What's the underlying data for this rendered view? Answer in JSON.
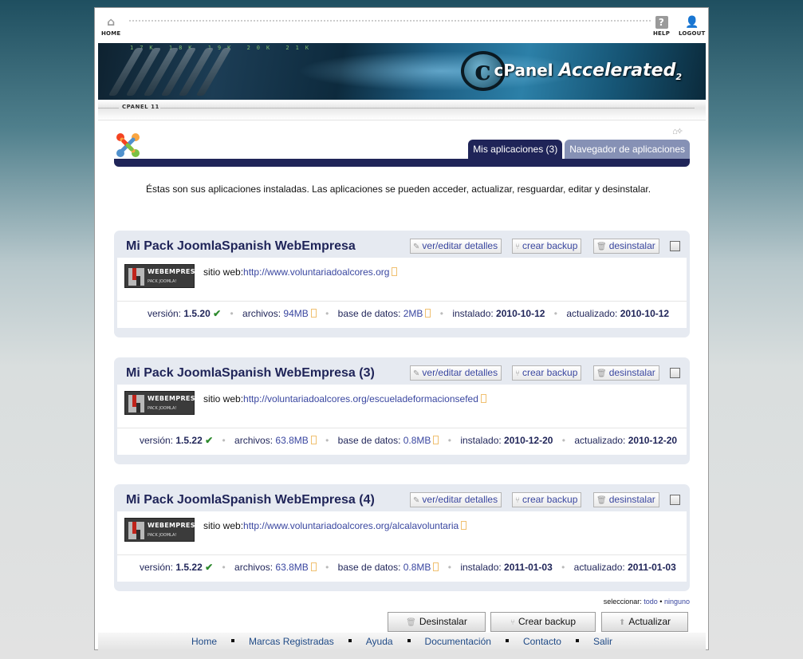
{
  "topnav": {
    "home": "HOME",
    "help": "HELP",
    "logout": "LOGOUT"
  },
  "banner": {
    "logo_c": "c",
    "brand": "cPanel",
    "accelerated": "Accelerated",
    "version": "2",
    "numbers": "17K 18K 19K 20K 21K"
  },
  "strip": {
    "label": "CPANEL 11"
  },
  "tabs": [
    {
      "label": "Mis aplicaciones (3)",
      "active": true
    },
    {
      "label": "Navegador de aplicaciones",
      "active": false
    }
  ],
  "intro": "Éstas son sus aplicaciones instaladas. Las aplicaciones se pueden acceder, actualizar, resguardar, editar y desinstalar.",
  "card_actions": {
    "edit": "ver/editar detalles",
    "backup": "crear backup",
    "uninstall": "desinstalar"
  },
  "labels": {
    "site": "sitio web:",
    "version": "versión:",
    "files": "archivos:",
    "db": "base de datos:",
    "installed": "instalado:",
    "updated": "actualizado:"
  },
  "apps": [
    {
      "title": "Mi Pack JoomlaSpanish WebEmpresa",
      "url": "http://www.voluntariadoalcores.org",
      "version": "1.5.20",
      "files": "94MB",
      "db": "2MB",
      "installed": "2010-10-12",
      "updated": "2010-10-12"
    },
    {
      "title": "Mi Pack JoomlaSpanish WebEmpresa (3)",
      "url": "http://voluntariadoalcores.org/escueladeformacionsefed",
      "version": "1.5.22",
      "files": "63.8MB",
      "db": "0.8MB",
      "installed": "2010-12-20",
      "updated": "2010-12-20"
    },
    {
      "title": "Mi Pack JoomlaSpanish WebEmpresa (4)",
      "url": "http://www.voluntariadoalcores.org/alcalavoluntaria",
      "version": "1.5.22",
      "files": "63.8MB",
      "db": "0.8MB",
      "installed": "2011-01-03",
      "updated": "2011-01-03"
    }
  ],
  "app_logo": {
    "line1": "WEBEMPRESA",
    "line2": "PACK JOOMLA!"
  },
  "select": {
    "label": "seleccionar:",
    "all": "todo",
    "none": "ninguno"
  },
  "actions": {
    "uninstall": "Desinstalar",
    "backup": "Crear backup",
    "update": "Actualizar"
  },
  "footer": [
    "Home",
    "Marcas Registradas",
    "Ayuda",
    "Documentación",
    "Contacto",
    "Salir"
  ],
  "colors": {
    "accent": "#1f2458",
    "link": "#3a47a0",
    "tab_inactive": "#8691b5",
    "card_bg": "#e6eaf1",
    "ok": "#2d8a2d"
  }
}
